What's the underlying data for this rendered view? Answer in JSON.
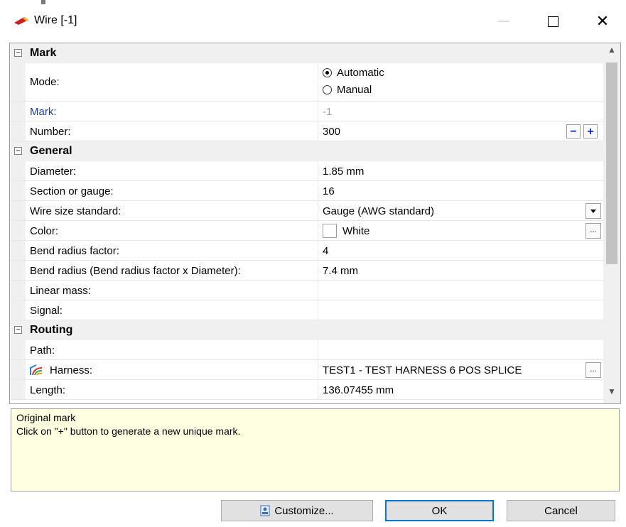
{
  "window": {
    "title": "Wire [-1]",
    "minimize_icon": "minimize-icon",
    "maximize_icon": "maximize-icon",
    "close_icon": "close-icon"
  },
  "categories": {
    "mark": "Mark",
    "general": "General",
    "routing": "Routing"
  },
  "toggle_symbol": "−",
  "props": {
    "mode": {
      "name": "Mode:",
      "options": [
        "Automatic",
        "Manual"
      ],
      "selected": "Automatic"
    },
    "mark": {
      "name": "Mark:",
      "value": "-1"
    },
    "number": {
      "name": "Number:",
      "value": "300",
      "minus_label": "−",
      "plus_label": "+"
    },
    "diameter": {
      "name": "Diameter:",
      "value": "1.85 mm"
    },
    "section": {
      "name": "Section or gauge:",
      "value": "16"
    },
    "wire_size": {
      "name": "Wire size standard:",
      "value": "Gauge (AWG standard)"
    },
    "color": {
      "name": "Color:",
      "value": "White",
      "swatch": "#ffffff",
      "button_label": "..."
    },
    "bend_factor": {
      "name": "Bend radius factor:",
      "value": "4"
    },
    "bend_radius": {
      "name": "Bend radius (Bend radius factor x Diameter):",
      "value": "7.4 mm"
    },
    "linear_mass": {
      "name": "Linear mass:",
      "value": ""
    },
    "signal": {
      "name": "Signal:",
      "value": ""
    },
    "path": {
      "name": "Path:",
      "value": ""
    },
    "harness": {
      "name": "Harness:",
      "value": "TEST1 - TEST HARNESS 6 POS SPLICE",
      "button_label": "..."
    },
    "length": {
      "name": "Length:",
      "value": "136.07455 mm"
    }
  },
  "scroll": {
    "up": "▲",
    "down": "▼"
  },
  "help": {
    "title": "Original mark",
    "text": "Click on \"+\" button to generate a new unique mark."
  },
  "buttons": {
    "customize": "Customize...",
    "ok": "OK",
    "cancel": "Cancel"
  },
  "colors": {
    "accent": "#0078d7",
    "help_bg": "#ffffe1",
    "category_bg": "#f0f0f0",
    "mark_label": "#1f3cae",
    "spin_glyph": "#0a1ec8"
  }
}
